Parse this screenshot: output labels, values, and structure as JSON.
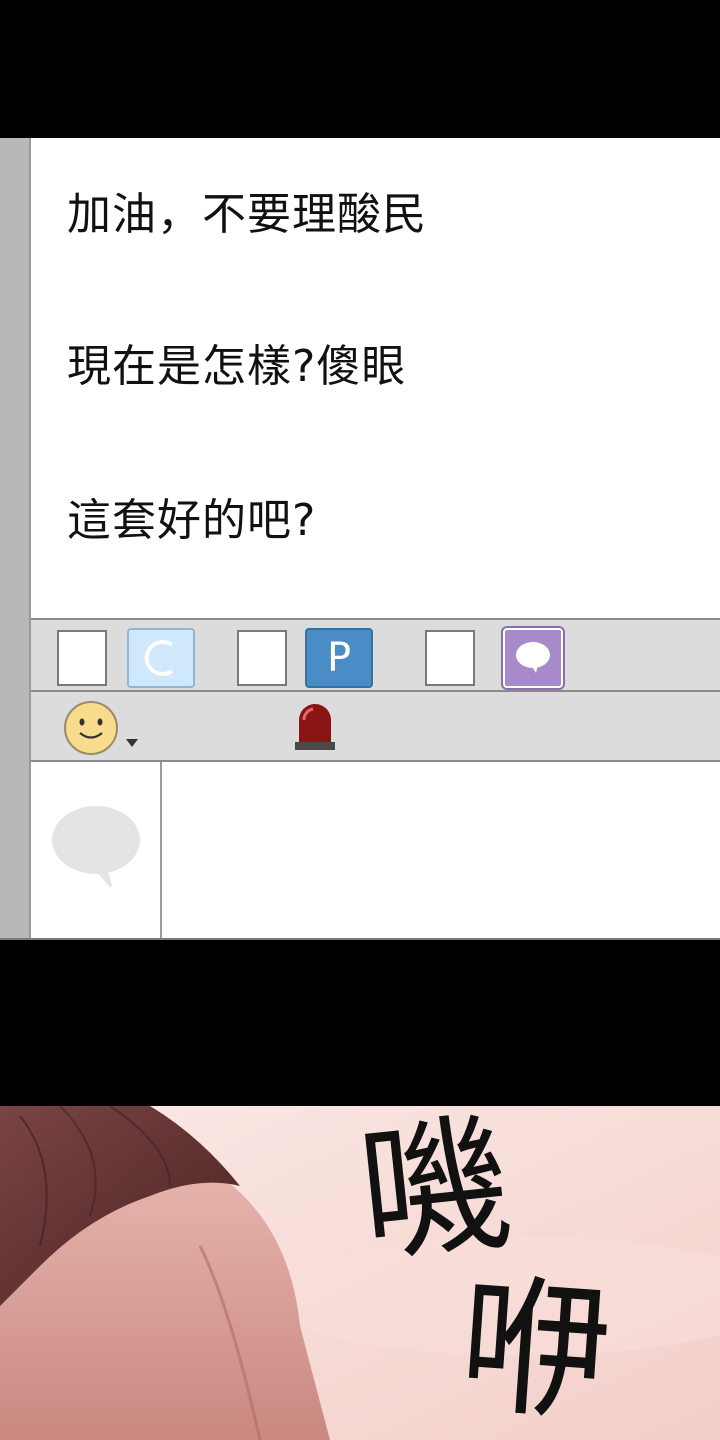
{
  "messages": [
    "加油，不要理酸民",
    "現在是怎樣?傻眼",
    "這套好的吧?"
  ],
  "toolbar": {
    "badges": [
      {
        "icon": "c-icon",
        "letter": "C",
        "color": "#cfe8fb"
      },
      {
        "icon": "p-icon",
        "letter": "P",
        "color": "#4a8cc6"
      },
      {
        "icon": "speech-bubble-icon",
        "color": "#a78ac9"
      }
    ],
    "emoji_icon": "smiley-icon",
    "alert_icon": "siren-icon"
  },
  "input": {
    "avatar_icon": "speech-bubble-icon",
    "value": ""
  },
  "sound_effect": {
    "line1": "嘰",
    "line2": "咿"
  },
  "colors": {
    "panel_gray": "#dcdcdc",
    "rail_gray": "#b8b8b8",
    "skin": "#e9c3bd",
    "hair": "#6b3a3a"
  }
}
